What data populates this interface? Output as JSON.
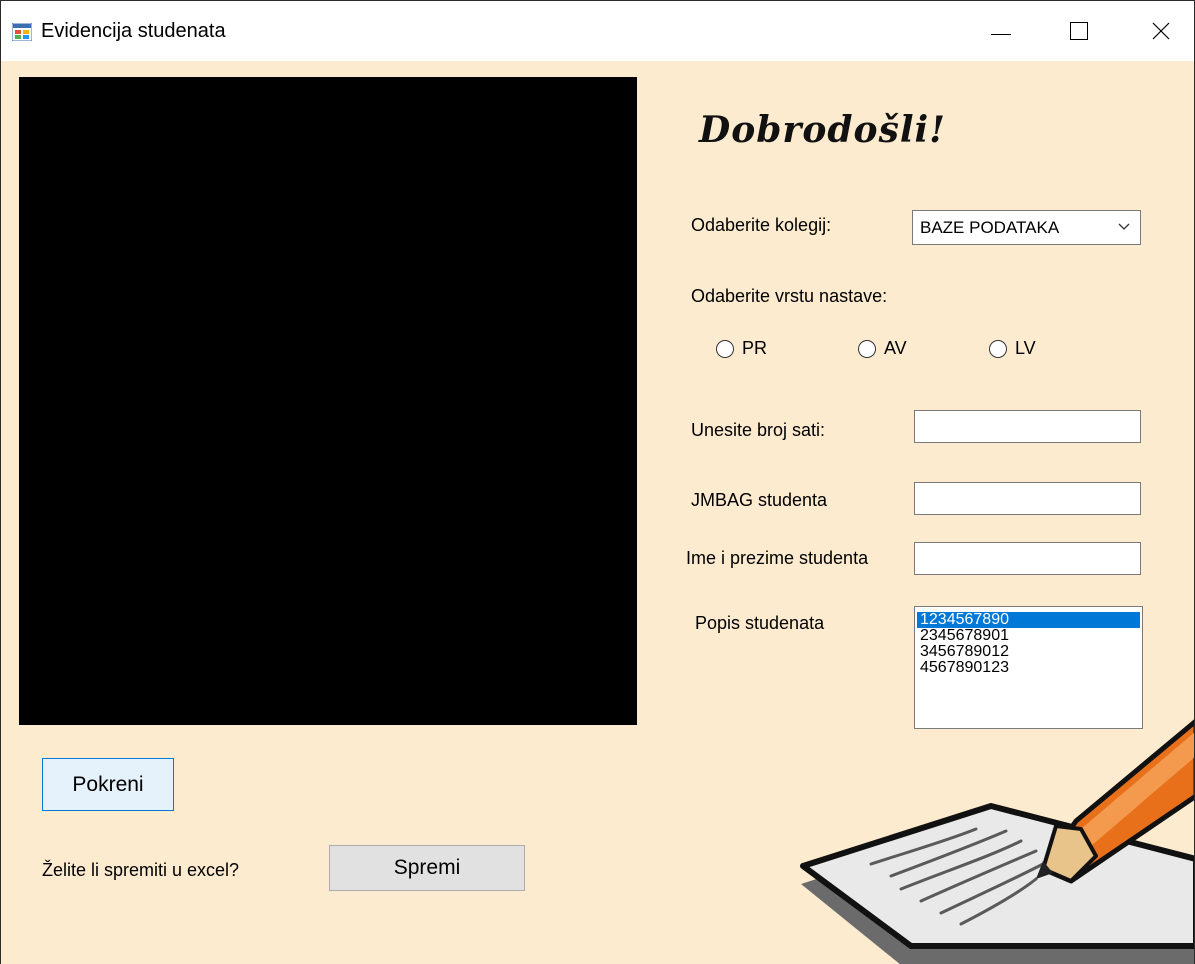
{
  "window": {
    "title": "Evidencija studenata",
    "icon": "windows-forms-app-icon",
    "controls": [
      "minimize-icon",
      "maximize-icon",
      "close-icon"
    ]
  },
  "welcome": {
    "text": "Dobrodošli!"
  },
  "course": {
    "label": "Odaberite kolegij:",
    "selected": "BAZE PODATAKA"
  },
  "teaching_type": {
    "label": "Odaberite vrstu nastave:",
    "options": [
      {
        "label": "PR",
        "checked": false
      },
      {
        "label": "AV",
        "checked": false
      },
      {
        "label": "LV",
        "checked": false
      }
    ]
  },
  "hours": {
    "label": "Unesite broj sati:",
    "value": ""
  },
  "jmbag": {
    "label": "JMBAG studenta",
    "value": ""
  },
  "name": {
    "label": "Ime i prezime studenta",
    "value": ""
  },
  "students": {
    "label": "Popis studenata",
    "items": [
      "1234567890",
      "2345678901",
      "3456789012",
      "4567890123"
    ],
    "selected_index": 0
  },
  "buttons": {
    "start": "Pokreni",
    "save_prompt": "Želite li spremiti u excel?",
    "save": "Spremi"
  },
  "colors": {
    "form_background": "#fdebd0",
    "video_background": "#000000",
    "selection": "#0078d7",
    "pencil": "#e8701a"
  }
}
